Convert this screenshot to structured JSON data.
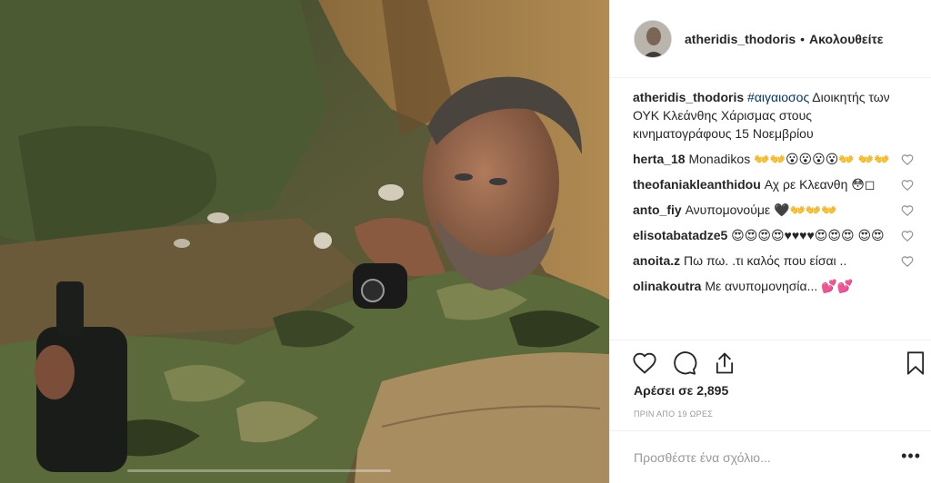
{
  "post": {
    "username": "atheridis_thodoris",
    "separator": "•",
    "follow_label": "Ακολουθείτε",
    "caption": {
      "username": "atheridis_thodoris",
      "hashtag": "#αιγαιοσος",
      "text": " Διοικητής των ΟΥΚ Κλεάνθης Χάρισμας στους κινηματογράφους 15 Νοεμβρίου"
    },
    "comments": [
      {
        "username": "herta_18",
        "text": "Monadikos 👐👐😮😮😮😮👐 👐👐"
      },
      {
        "username": "theofaniakleanthidou",
        "text": "Αχ ρε Κλεανθη 😳◻"
      },
      {
        "username": "anto_fiy",
        "text": "Ανυπομονούμε 🖤👐👐👐"
      },
      {
        "username": "elisotabatadze5",
        "text": "😍😍😍😍♥♥♥♥😍😍😍 😍😍"
      },
      {
        "username": "anoita.z",
        "text": "Πω πω. .τι καλός που είσαι .."
      },
      {
        "username": "olinakoutra",
        "text": "Με ανυπομονησία... 💕💕"
      }
    ],
    "likes_text": "Αρέσει σε 2,895",
    "time_ago": "ΠΡΙΝ ΑΠΟ 19 ΩΡΕΣ",
    "add_comment_placeholder": "Προσθέστε ένα σχόλιο...",
    "more_label": "•••"
  },
  "icons": {
    "like": "heart-icon",
    "comment": "comment-bubble-icon",
    "share": "share-icon",
    "save": "bookmark-icon"
  }
}
